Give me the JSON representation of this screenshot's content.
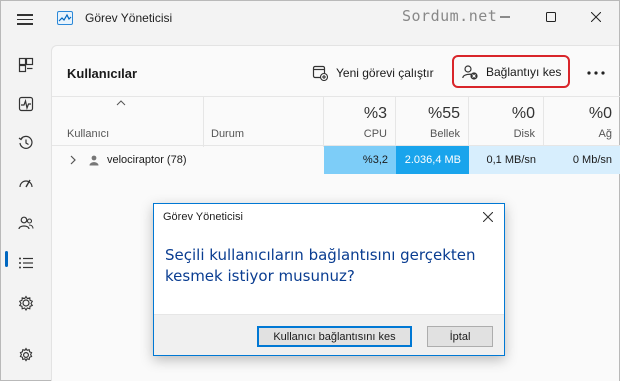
{
  "app": {
    "title": "Görev Yöneticisi",
    "watermark": "Sordum.net"
  },
  "nav": {
    "items": [
      "processes-icon",
      "performance-icon",
      "app-history-icon",
      "startup-icon",
      "users-icon",
      "details-icon",
      "services-icon"
    ],
    "settings": "gear-icon",
    "active": "users-icon"
  },
  "page": {
    "title": "Kullanıcılar"
  },
  "toolbar": {
    "new_task_label": "Yeni görevi çalıştır",
    "disconnect_label": "Bağlantıyı kes",
    "more_label": "•••"
  },
  "table": {
    "columns": [
      {
        "key": "user",
        "label": "Kullanıcı"
      },
      {
        "key": "status",
        "label": "Durum"
      },
      {
        "key": "cpu",
        "label": "CPU",
        "pct": "%3"
      },
      {
        "key": "memory",
        "label": "Bellek",
        "pct": "%55"
      },
      {
        "key": "disk",
        "label": "Disk",
        "pct": "%0"
      },
      {
        "key": "network",
        "label": "Ağ",
        "pct": "%0"
      }
    ],
    "rows": [
      {
        "user": "velociraptor (78)",
        "status": "",
        "cpu": "%3,2",
        "memory": "2.036,4 MB",
        "disk": "0,1 MB/sn",
        "network": "0 Mb/sn"
      }
    ]
  },
  "dialog": {
    "title": "Görev Yöneticisi",
    "message": "Seçili kullanıcıların bağlantısını gerçekten kesmek istiyor musunuz?",
    "primary_label": "Kullanıcı bağlantısını kes",
    "cancel_label": "İptal"
  },
  "colors": {
    "accent": "#0067c0",
    "highlight_border": "#d9252a",
    "cpu_fill": "#7dcdf8",
    "memory_fill": "#19a4ec",
    "io_fill": "#d7eefd",
    "dialog_text": "#0a3d91"
  }
}
